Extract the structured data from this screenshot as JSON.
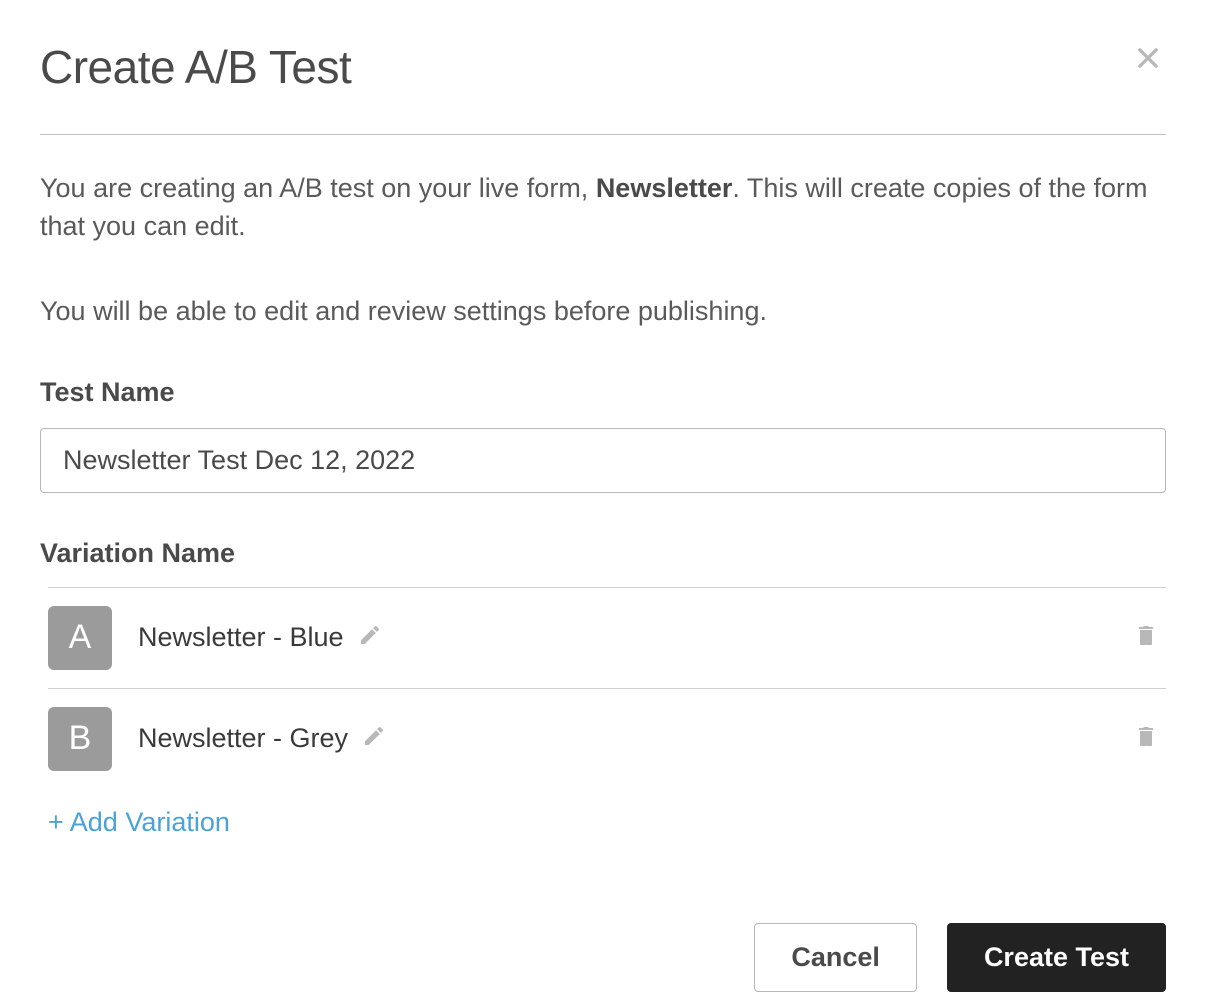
{
  "modal": {
    "title": "Create A/B Test",
    "description_prefix": "You are creating an A/B test on your live form, ",
    "form_name": "Newsletter",
    "description_suffix": ". This will create copies of the form that you can edit.",
    "sub_description": "You will be able to edit and review settings before publishing."
  },
  "test_name": {
    "label": "Test Name",
    "value": "Newsletter Test Dec 12, 2022"
  },
  "variation": {
    "label": "Variation Name",
    "items": [
      {
        "letter": "A",
        "name": "Newsletter - Blue"
      },
      {
        "letter": "B",
        "name": "Newsletter - Grey"
      }
    ],
    "add_label": "+ Add Variation"
  },
  "footer": {
    "cancel_label": "Cancel",
    "create_label": "Create Test"
  }
}
